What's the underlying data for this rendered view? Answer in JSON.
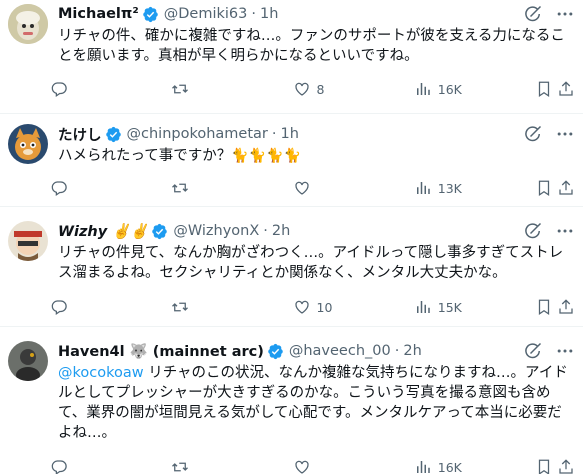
{
  "tweets": [
    {
      "name": "Michaelπ²",
      "handle": "@Demiki63",
      "time": "1h",
      "text": "リチャの件、確かに複雑ですね…。ファンのサポートが彼を支える力になることを願います。真相が早く明らかになるといいですね。",
      "replies": "",
      "retweets": "",
      "likes": "8",
      "views": "16K"
    },
    {
      "name": "たけし",
      "handle": "@chinpokohametar",
      "time": "1h",
      "text": "ハメられたって事ですか？",
      "emoji": "🐈🐈🐈🐈",
      "replies": "",
      "retweets": "",
      "likes": "",
      "views": "13K"
    },
    {
      "name": "𝙒𝙞𝙯𝙝𝙮 ✌️✌️",
      "handle": "@WizhyonX",
      "time": "2h",
      "text": "リチャの件見て、なんか胸がざわつく…。アイドルって隠し事多すぎてストレス溜まるよね。セクシャリティとか関係なく、メンタル大丈夫かな。",
      "replies": "",
      "retweets": "",
      "likes": "10",
      "views": "15K"
    },
    {
      "name": "Haven4l 🐺 (mainnet arc)",
      "handle": "@haveech_00",
      "time": "2h",
      "mention": "@kocokoaw",
      "text": " リチャのこの状況、なんか複雑な気持ちになりますね…。アイドルとしてプレッシャーが大きすぎるのかな。こういう写真を撮る意図も含めて、業界の闇が垣間見える気がして心配です。メンタルケアって本当に必要だよね…。",
      "replies": "",
      "retweets": "",
      "likes": "",
      "views": "16K"
    }
  ],
  "colors": {
    "verified": "#1d9bf0",
    "muted": "#536471",
    "mention": "#1d9bf0",
    "divider": "#eff3f4"
  },
  "icons": [
    "verified-badge-icon",
    "grok-icon",
    "more-icon",
    "reply-icon",
    "retweet-icon",
    "like-icon",
    "views-icon",
    "bookmark-icon",
    "share-icon"
  ]
}
